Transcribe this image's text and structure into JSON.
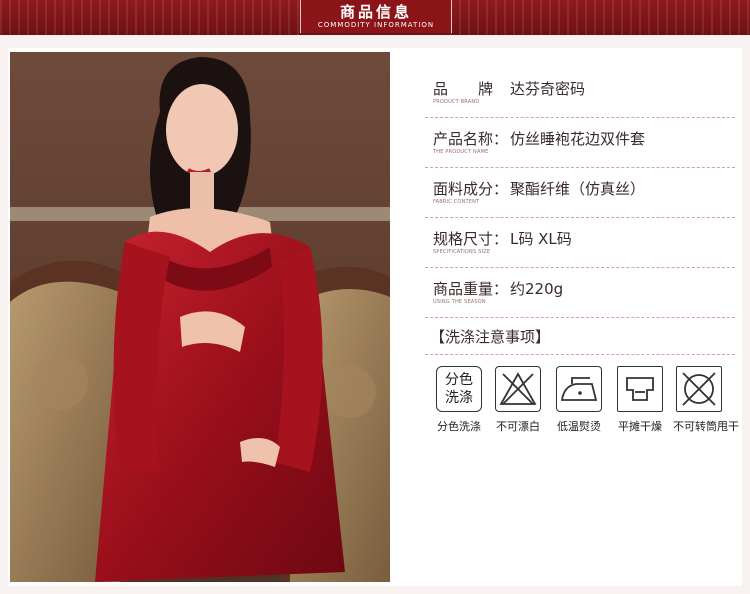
{
  "banner": {
    "title": "商品信息",
    "subtitle": "COMMODITY INFORMATION"
  },
  "info": [
    {
      "label": "品　　牌",
      "value": "达芬奇密码",
      "en": "PRODUCT BRAND"
    },
    {
      "label": "产品名称：",
      "value": "仿丝睡袍花边双件套",
      "en": "THE PRODUCT NAME"
    },
    {
      "label": "面料成分：",
      "value": "聚酯纤维（仿真丝）",
      "en": "FABRIC CONTENT"
    },
    {
      "label": "规格尺寸：",
      "value": "L码 XL码",
      "en": "SPECIFICATIONS SIZE"
    },
    {
      "label": "商品重量：",
      "value": "约220g",
      "en": "USING THE SEASON"
    }
  ],
  "care": {
    "title": "【洗涤注意事项】",
    "items": [
      {
        "label": "分色洗涤",
        "icon": "separate-wash-icon",
        "box_text_1": "分色",
        "box_text_2": "洗涤"
      },
      {
        "label": "不可漂白",
        "icon": "no-bleach-icon"
      },
      {
        "label": "低温熨烫",
        "icon": "low-iron-icon"
      },
      {
        "label": "平摊干燥",
        "icon": "flat-dry-icon"
      },
      {
        "label": "不可转筒甩干",
        "icon": "no-tumble-dry-icon"
      }
    ]
  },
  "colors": {
    "banner": "#7d1418",
    "dress": "#a5141f",
    "dashed": "#d4a3a0"
  }
}
